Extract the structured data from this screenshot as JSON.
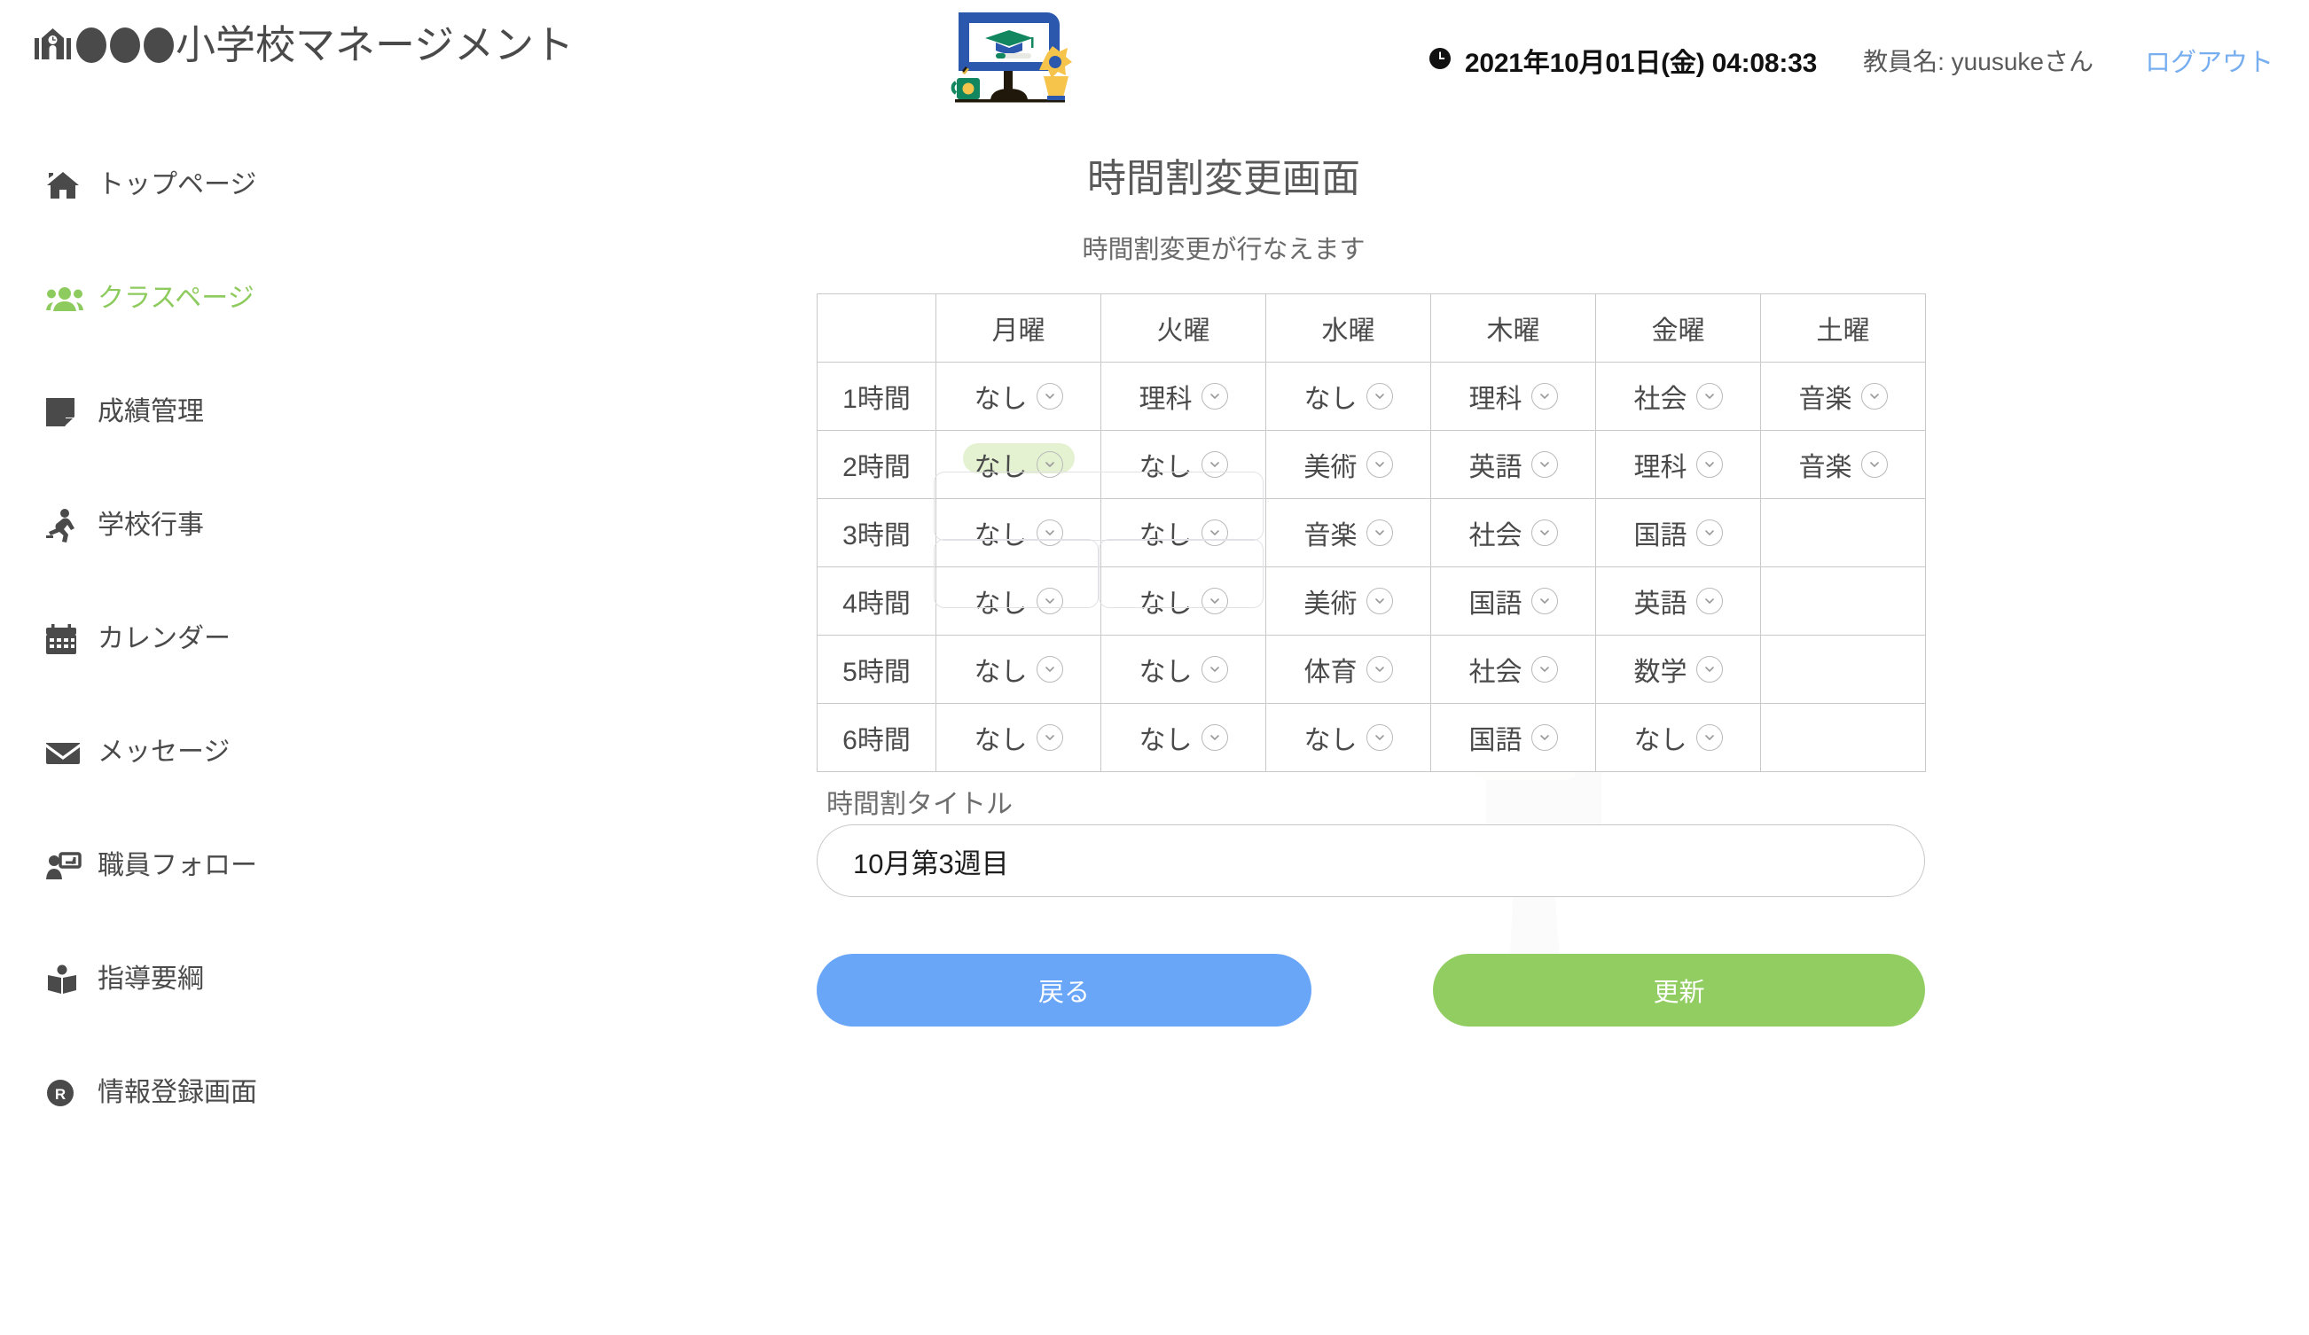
{
  "header": {
    "brand_text": "小学校マネージメント",
    "brand_icon": "school-building-icon",
    "brand_dots_count": 3,
    "logo_icon": "e-learning-monitor-illustration",
    "clock_icon": "clock-icon",
    "datetime": "2021年10月01日(金) 04:08:33",
    "teacher_label": "教員名: yuusukeさん",
    "logout_label": "ログアウト",
    "logout_color": "#77aef0"
  },
  "sidebar": {
    "active_color": "#8ecb5e",
    "items": [
      {
        "label": "トップページ",
        "icon": "home-icon",
        "active": false
      },
      {
        "label": "クラスページ",
        "icon": "users-icon",
        "active": true
      },
      {
        "label": "成績管理",
        "icon": "note-icon",
        "active": false
      },
      {
        "label": "学校行事",
        "icon": "running-icon",
        "active": false
      },
      {
        "label": "カレンダー",
        "icon": "calendar-icon",
        "active": false
      },
      {
        "label": "メッセージ",
        "icon": "envelope-icon",
        "active": false
      },
      {
        "label": "職員フォロー",
        "icon": "user-screen-icon",
        "active": false
      },
      {
        "label": "指導要綱",
        "icon": "book-reader-icon",
        "active": false
      },
      {
        "label": "情報登録画面",
        "icon": "registered-r-icon",
        "active": false
      }
    ]
  },
  "main": {
    "page_title": "時間割変更画面",
    "page_subtitle": "時間割変更が行なえます",
    "field_label": "時間割タイトル",
    "title_input_value": "10月第3週目",
    "title_input_placeholder": "時間割タイトル",
    "back_button_label": "戻る",
    "back_button_color": "#6aa6f7",
    "update_button_label": "更新",
    "update_button_color": "#92cd62"
  },
  "timetable": {
    "corner_label": "",
    "columns": [
      "月曜",
      "火曜",
      "水曜",
      "木曜",
      "金曜",
      "土曜"
    ],
    "row_labels": [
      "1時間",
      "2時間",
      "3時間",
      "4時間",
      "5時間",
      "6時間"
    ],
    "dropdown_icon": "chevron-down-circle-icon",
    "highlight_color": "#e4f2d2",
    "rows": [
      {
        "label": "1時間",
        "cells": [
          "なし",
          "理科",
          "なし",
          "理科",
          "社会",
          "音楽"
        ]
      },
      {
        "label": "2時間",
        "cells": [
          "なし",
          "なし",
          "美術",
          "英語",
          "理科",
          "音楽"
        ]
      },
      {
        "label": "3時間",
        "cells": [
          "なし",
          "なし",
          "音楽",
          "社会",
          "国語",
          ""
        ]
      },
      {
        "label": "4時間",
        "cells": [
          "なし",
          "なし",
          "美術",
          "国語",
          "英語",
          ""
        ]
      },
      {
        "label": "5時間",
        "cells": [
          "なし",
          "なし",
          "体育",
          "社会",
          "数学",
          ""
        ]
      },
      {
        "label": "6時間",
        "cells": [
          "なし",
          "なし",
          "なし",
          "国語",
          "なし",
          ""
        ]
      }
    ],
    "highlighted_cell": {
      "row": 1,
      "col": 0
    }
  }
}
